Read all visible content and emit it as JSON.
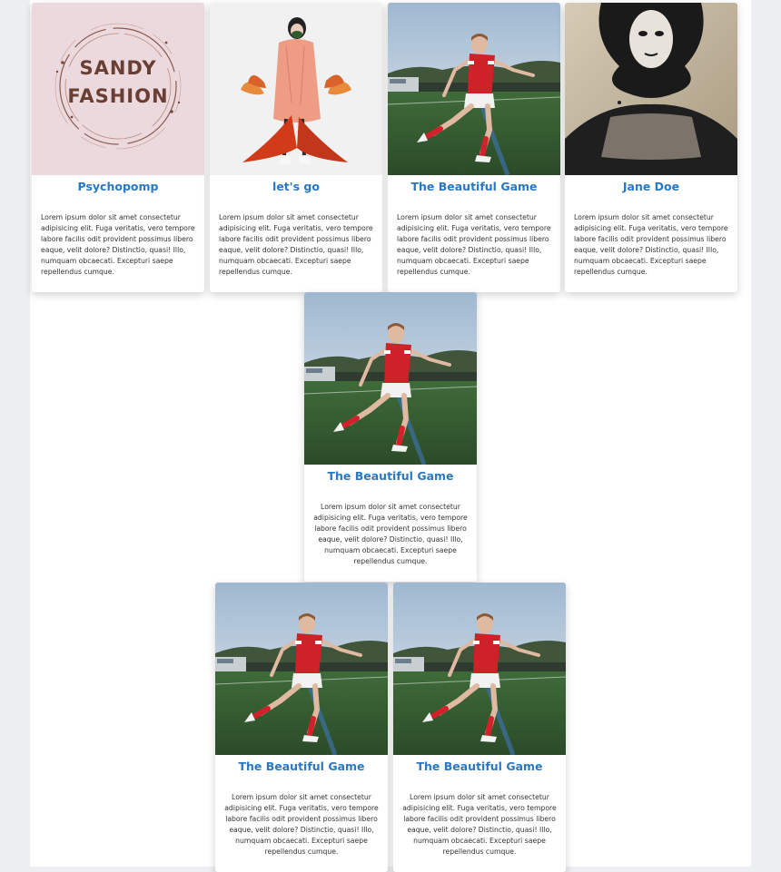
{
  "theme": {
    "title_color": "#2a78c2",
    "text_color": "#333333",
    "page_background": "#ffffff",
    "outer_background": "#eceef1"
  },
  "cards": [
    {
      "title": "Psychopomp",
      "image": "sandy-fashion-logo",
      "logo_line1": "SANDY",
      "logo_line2": "FASHION",
      "text": "Lorem ipsum dolor sit amet consectetur adipisicing elit. Fuga veritatis, vero tempore labore facilis odit provident possimus libero eaque, velit dolore? Distinctio, quasi! Illo, numquam obcaecati. Excepturi saepe repellendus cumque."
    },
    {
      "title": "let's go",
      "image": "fashion-illustration",
      "text": "Lorem ipsum dolor sit amet consectetur adipisicing elit. Fuga veritatis, vero tempore labore facilis odit provident possimus libero eaque, velit dolore? Distinctio, quasi! Illo, numquam obcaecati. Excepturi saepe repellendus cumque."
    },
    {
      "title": "The Beautiful Game",
      "image": "soccer-player-photo",
      "text": "Lorem ipsum dolor sit amet consectetur adipisicing elit. Fuga veritatis, vero tempore labore facilis odit provident possimus libero eaque, velit dolore? Distinctio, quasi! Illo, numquam obcaecati. Excepturi saepe repellendus cumque."
    },
    {
      "title": "Jane Doe",
      "image": "portrait-artwork",
      "text": "Lorem ipsum dolor sit amet consectetur adipisicing elit. Fuga veritatis, vero tempore labore facilis odit provident possimus libero eaque, velit dolore? Distinctio, quasi! Illo, numquam obcaecati. Excepturi saepe repellendus cumque."
    },
    {
      "title": "The Beautiful Game",
      "image": "soccer-player-photo",
      "text": "Lorem ipsum dolor sit amet consectetur adipisicing elit. Fuga veritatis, vero tempore labore facilis odit provident possimus libero eaque, velit dolore? Distinctio, quasi! Illo, numquam obcaecati. Excepturi saepe repellendus cumque."
    },
    {
      "title": "The Beautiful Game",
      "image": "soccer-player-photo",
      "text": "Lorem ipsum dolor sit amet consectetur adipisicing elit. Fuga veritatis, vero tempore labore facilis odit provident possimus libero eaque, velit dolore? Distinctio, quasi! Illo, numquam obcaecati. Excepturi saepe repellendus cumque."
    },
    {
      "title": "The Beautiful Game",
      "image": "soccer-player-photo",
      "text": "Lorem ipsum dolor sit amet consectetur adipisicing elit. Fuga veritatis, vero tempore labore facilis odit provident possimus libero eaque, velit dolore? Distinctio, quasi! Illo, numquam obcaecati. Excepturi saepe repellendus cumque."
    }
  ]
}
